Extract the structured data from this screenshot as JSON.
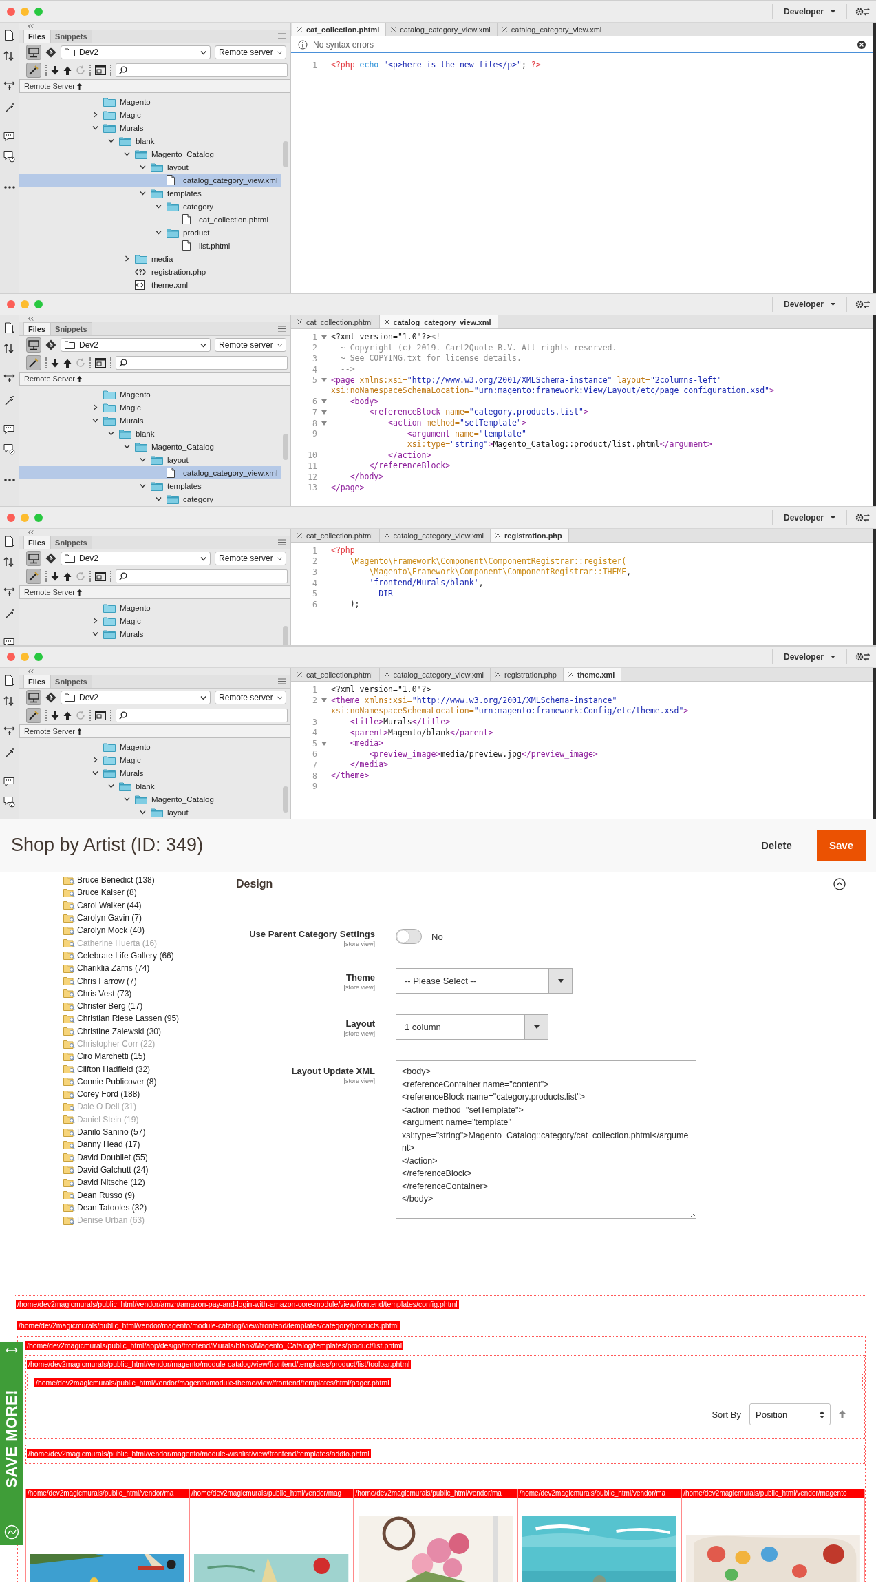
{
  "ide": {
    "panels": [
      {
        "workspace": "Developer",
        "files_tabs": [
          {
            "label": "Files",
            "selected": true
          },
          {
            "label": "Snippets",
            "selected": false
          }
        ],
        "site": "Dev2",
        "server": "Remote server",
        "tree_header": "Remote Server",
        "tree": [
          {
            "label": "Magento",
            "kind": "folder",
            "selected": false
          },
          {
            "label": "Magic",
            "kind": "folder",
            "expanded": false,
            "selected": false
          },
          {
            "label": "Murals",
            "kind": "folder",
            "expanded": true,
            "selected": false,
            "children": [
              {
                "label": "blank",
                "kind": "folder",
                "expanded": true,
                "selected": false,
                "children": [
                  {
                    "label": "Magento_Catalog",
                    "kind": "folder",
                    "expanded": true,
                    "selected": false,
                    "children": [
                      {
                        "label": "layout",
                        "kind": "folder",
                        "expanded": true,
                        "selected": false,
                        "children": [
                          {
                            "label": "catalog_category_view.xml",
                            "kind": "document",
                            "selected": true
                          }
                        ]
                      },
                      {
                        "label": "templates",
                        "kind": "folder",
                        "expanded": true,
                        "selected": false,
                        "children": [
                          {
                            "label": "category",
                            "kind": "folder",
                            "expanded": true,
                            "selected": false,
                            "children": [
                              {
                                "label": "cat_collection.phtml",
                                "kind": "document",
                                "selected": false
                              }
                            ]
                          },
                          {
                            "label": "product",
                            "kind": "folder",
                            "expanded": true,
                            "selected": false,
                            "children": [
                              {
                                "label": "list.phtml",
                                "kind": "document",
                                "selected": false
                              }
                            ]
                          }
                        ]
                      }
                    ]
                  },
                  {
                    "label": "media",
                    "kind": "folder",
                    "expanded": false,
                    "selected": false
                  },
                  {
                    "label": "registration.php",
                    "kind": "script",
                    "selected": false
                  },
                  {
                    "label": "theme.xml",
                    "kind": "markup",
                    "selected": false
                  }
                ]
              }
            ]
          }
        ],
        "editor_tabs": [
          {
            "label": "cat_collection.phtml",
            "selected": true
          },
          {
            "label": "catalog_category_view.xml",
            "selected": false
          },
          {
            "label": "catalog_category_view.xml",
            "selected": false
          }
        ],
        "status_message": "No syntax errors",
        "lines": [
          {
            "number": "1",
            "foldable": false,
            "tokens": [
              {
                "kind": "php",
                "text": "<?php"
              },
              {
                "kind": "keyword",
                "text": " echo "
              },
              {
                "kind": "string",
                "text": "\"<p>here is the new file</p>\""
              },
              {
                "kind": "plain",
                "text": "; "
              },
              {
                "kind": "php",
                "text": "?>"
              }
            ]
          }
        ]
      },
      {
        "workspace": "Developer",
        "files_tabs": [
          {
            "label": "Files",
            "selected": true
          },
          {
            "label": "Snippets",
            "selected": false
          }
        ],
        "site": "Dev2",
        "server": "Remote server",
        "tree_header": "Remote Server",
        "tree": [
          {
            "label": "Magento",
            "kind": "folder",
            "selected": false
          },
          {
            "label": "Magic",
            "kind": "folder",
            "expanded": false,
            "selected": false
          },
          {
            "label": "Murals",
            "kind": "folder",
            "expanded": true,
            "selected": false,
            "children": [
              {
                "label": "blank",
                "kind": "folder",
                "expanded": true,
                "selected": false,
                "children": [
                  {
                    "label": "Magento_Catalog",
                    "kind": "folder",
                    "expanded": true,
                    "selected": false,
                    "children": [
                      {
                        "label": "layout",
                        "kind": "folder",
                        "expanded": true,
                        "selected": false,
                        "children": [
                          {
                            "label": "catalog_category_view.xml",
                            "kind": "document",
                            "selected": true
                          }
                        ]
                      },
                      {
                        "label": "templates",
                        "kind": "folder",
                        "expanded": true,
                        "selected": false,
                        "children": [
                          {
                            "label": "category",
                            "kind": "folder",
                            "expanded": true,
                            "selected": false
                          }
                        ]
                      }
                    ]
                  }
                ]
              }
            ]
          }
        ],
        "editor_tabs": [
          {
            "label": "cat_collection.phtml",
            "selected": false
          },
          {
            "label": "catalog_category_view.xml",
            "selected": true
          }
        ],
        "lines": [
          {
            "number": "1",
            "foldable": true,
            "tokens": [
              {
                "kind": "plain",
                "text": "<?xml version=\"1.0\"?>"
              },
              {
                "kind": "comment",
                "text": "<!--"
              }
            ]
          },
          {
            "number": "2",
            "foldable": false,
            "tokens": [
              {
                "kind": "comment",
                "text": "  ~ Copyright (c) 2019. Cart2Quote B.V. All rights reserved."
              }
            ]
          },
          {
            "number": "3",
            "foldable": false,
            "tokens": [
              {
                "kind": "comment",
                "text": "  ~ See COPYING.txt for license details."
              }
            ]
          },
          {
            "number": "4",
            "foldable": false,
            "tokens": [
              {
                "kind": "comment",
                "text": "  -->"
              }
            ]
          },
          {
            "number": "5",
            "foldable": true,
            "tokens": [
              {
                "kind": "tag",
                "text": "<page"
              },
              {
                "kind": "attr",
                "text": " xmlns:xsi="
              },
              {
                "kind": "string",
                "text": "\"http://www.w3.org/2001/XMLSchema-instance\""
              },
              {
                "kind": "attr",
                "text": " layout="
              },
              {
                "kind": "string",
                "text": "\"2columns-left\""
              }
            ]
          },
          {
            "foldable": false,
            "tokens": [
              {
                "kind": "attr",
                "text": "xsi:noNamespaceSchemaLocation="
              },
              {
                "kind": "string",
                "text": "\"urn:magento:framework:View/Layout/etc/page_configuration.xsd\""
              },
              {
                "kind": "tag",
                "text": ">"
              }
            ]
          },
          {
            "number": "6",
            "foldable": true,
            "tokens": [
              {
                "kind": "tag",
                "text": "    <body>"
              }
            ]
          },
          {
            "number": "7",
            "foldable": true,
            "tokens": [
              {
                "kind": "tag",
                "text": "        <referenceBlock"
              },
              {
                "kind": "attr",
                "text": " name="
              },
              {
                "kind": "string",
                "text": "\"category.products.list\""
              },
              {
                "kind": "tag",
                "text": ">"
              }
            ]
          },
          {
            "number": "8",
            "foldable": true,
            "tokens": [
              {
                "kind": "tag",
                "text": "            <action"
              },
              {
                "kind": "attr",
                "text": " method="
              },
              {
                "kind": "string",
                "text": "\"setTemplate\""
              },
              {
                "kind": "tag",
                "text": ">"
              }
            ]
          },
          {
            "number": "9",
            "foldable": false,
            "tokens": [
              {
                "kind": "tag",
                "text": "                <argument"
              },
              {
                "kind": "attr",
                "text": " name="
              },
              {
                "kind": "string",
                "text": "\"template\""
              }
            ]
          },
          {
            "foldable": false,
            "tokens": [
              {
                "kind": "attr",
                "text": "                xsi:type="
              },
              {
                "kind": "string",
                "text": "\"string\""
              },
              {
                "kind": "tag",
                "text": ">"
              },
              {
                "kind": "plain",
                "text": "Magento_Catalog::product/list.phtml"
              },
              {
                "kind": "tag",
                "text": "</argument>"
              }
            ]
          },
          {
            "number": "10",
            "foldable": false,
            "tokens": [
              {
                "kind": "tag",
                "text": "            </action>"
              }
            ]
          },
          {
            "number": "11",
            "foldable": false,
            "tokens": [
              {
                "kind": "tag",
                "text": "        </referenceBlock>"
              }
            ]
          },
          {
            "number": "12",
            "foldable": false,
            "tokens": [
              {
                "kind": "tag",
                "text": "    </body>"
              }
            ]
          },
          {
            "number": "13",
            "foldable": false,
            "tokens": [
              {
                "kind": "tag",
                "text": "</page>"
              }
            ]
          }
        ]
      },
      {
        "workspace": "Developer",
        "files_tabs": [
          {
            "label": "Files",
            "selected": true
          },
          {
            "label": "Snippets",
            "selected": false
          }
        ],
        "site": "Dev2",
        "server": "Remote server",
        "tree_header": "Remote Server",
        "tree": [
          {
            "label": "Magento",
            "kind": "folder",
            "selected": false
          },
          {
            "label": "Magic",
            "kind": "folder",
            "expanded": false,
            "selected": false
          },
          {
            "label": "Murals",
            "kind": "folder",
            "expanded": true,
            "selected": false
          }
        ],
        "editor_tabs": [
          {
            "label": "cat_collection.phtml",
            "selected": false
          },
          {
            "label": "catalog_category_view.xml",
            "selected": false
          },
          {
            "label": "registration.php",
            "selected": true
          }
        ],
        "lines": [
          {
            "number": "1",
            "foldable": false,
            "tokens": [
              {
                "kind": "php",
                "text": "<?php"
              }
            ]
          },
          {
            "number": "2",
            "foldable": false,
            "tokens": [
              {
                "kind": "class",
                "text": "    \\Magento\\Framework\\Component\\ComponentRegistrar::register("
              }
            ]
          },
          {
            "number": "3",
            "foldable": false,
            "tokens": [
              {
                "kind": "class",
                "text": "        \\Magento\\Framework\\Component\\ComponentRegistrar::THEME"
              },
              {
                "kind": "plain",
                "text": ","
              }
            ]
          },
          {
            "number": "4",
            "foldable": false,
            "tokens": [
              {
                "kind": "string",
                "text": "        'frontend/Murals/blank'"
              },
              {
                "kind": "plain",
                "text": ","
              }
            ]
          },
          {
            "number": "5",
            "foldable": false,
            "tokens": [
              {
                "kind": "string",
                "text": "        __DIR__"
              }
            ]
          },
          {
            "number": "6",
            "foldable": false,
            "tokens": [
              {
                "kind": "plain",
                "text": "    );"
              }
            ]
          }
        ]
      },
      {
        "workspace": "Developer",
        "files_tabs": [
          {
            "label": "Files",
            "selected": true
          },
          {
            "label": "Snippets",
            "selected": false
          }
        ],
        "site": "Dev2",
        "server": "Remote server",
        "tree_header": "Remote Server",
        "tree": [
          {
            "label": "Magento",
            "kind": "folder",
            "selected": false
          },
          {
            "label": "Magic",
            "kind": "folder",
            "expanded": false,
            "selected": false
          },
          {
            "label": "Murals",
            "kind": "folder",
            "expanded": true,
            "selected": false,
            "children": [
              {
                "label": "blank",
                "kind": "folder",
                "expanded": true,
                "selected": false,
                "children": [
                  {
                    "label": "Magento_Catalog",
                    "kind": "folder",
                    "expanded": true,
                    "selected": false,
                    "children": [
                      {
                        "label": "layout",
                        "kind": "folder",
                        "expanded": true,
                        "selected": false
                      }
                    ]
                  }
                ]
              }
            ]
          }
        ],
        "editor_tabs": [
          {
            "label": "cat_collection.phtml",
            "selected": false
          },
          {
            "label": "catalog_category_view.xml",
            "selected": false
          },
          {
            "label": "registration.php",
            "selected": false
          },
          {
            "label": "theme.xml",
            "selected": true
          }
        ],
        "lines": [
          {
            "number": "1",
            "foldable": false,
            "tokens": [
              {
                "kind": "plain",
                "text": "<?xml version=\"1.0\"?>"
              }
            ]
          },
          {
            "number": "2",
            "foldable": true,
            "tokens": [
              {
                "kind": "tag",
                "text": "<theme"
              },
              {
                "kind": "attr",
                "text": " xmlns:xsi="
              },
              {
                "kind": "string",
                "text": "\"http://www.w3.org/2001/XMLSchema-instance\""
              }
            ]
          },
          {
            "foldable": false,
            "tokens": [
              {
                "kind": "attr",
                "text": "xsi:noNamespaceSchemaLocation="
              },
              {
                "kind": "string",
                "text": "\"urn:magento:framework:Config/etc/theme.xsd\""
              },
              {
                "kind": "tag",
                "text": ">"
              }
            ]
          },
          {
            "number": "3",
            "foldable": false,
            "tokens": [
              {
                "kind": "tag",
                "text": "    <title>"
              },
              {
                "kind": "plain",
                "text": "Murals"
              },
              {
                "kind": "tag",
                "text": "</title>"
              }
            ]
          },
          {
            "number": "4",
            "foldable": false,
            "tokens": [
              {
                "kind": "tag",
                "text": "    <parent>"
              },
              {
                "kind": "plain",
                "text": "Magento/blank"
              },
              {
                "kind": "tag",
                "text": "</parent>"
              }
            ]
          },
          {
            "number": "5",
            "foldable": true,
            "tokens": [
              {
                "kind": "tag",
                "text": "    <media>"
              }
            ]
          },
          {
            "number": "6",
            "foldable": false,
            "tokens": [
              {
                "kind": "tag",
                "text": "        <preview_image>"
              },
              {
                "kind": "plain",
                "text": "media/preview.jpg"
              },
              {
                "kind": "tag",
                "text": "</preview_image>"
              }
            ]
          },
          {
            "number": "7",
            "foldable": false,
            "tokens": [
              {
                "kind": "tag",
                "text": "    </media>"
              }
            ]
          },
          {
            "number": "8",
            "foldable": false,
            "tokens": [
              {
                "kind": "tag",
                "text": "</theme>"
              }
            ]
          },
          {
            "number": "9",
            "foldable": false
          }
        ]
      }
    ]
  },
  "admin": {
    "title": "Shop by Artist (ID: 349)",
    "delete": "Delete",
    "save": "Save",
    "artists": [
      {
        "label": "Bruce Benedict (138)",
        "disabled": false
      },
      {
        "label": "Bruce Kaiser (8)",
        "disabled": false
      },
      {
        "label": "Carol Walker (44)",
        "disabled": false
      },
      {
        "label": "Carolyn Gavin (7)",
        "disabled": false
      },
      {
        "label": "Carolyn Mock (40)",
        "disabled": false
      },
      {
        "label": "Catherine Huerta (16)",
        "disabled": true
      },
      {
        "label": "Celebrate Life Gallery (66)",
        "disabled": false
      },
      {
        "label": "Chariklia Zarris (74)",
        "disabled": false
      },
      {
        "label": "Chris Farrow (7)",
        "disabled": false
      },
      {
        "label": "Chris Vest (73)",
        "disabled": false
      },
      {
        "label": "Christer Berg (17)",
        "disabled": false
      },
      {
        "label": "Christian Riese Lassen (95)",
        "disabled": false
      },
      {
        "label": "Christine Zalewski (30)",
        "disabled": false
      },
      {
        "label": "Christopher Corr (22)",
        "disabled": true
      },
      {
        "label": "Ciro Marchetti (15)",
        "disabled": false
      },
      {
        "label": "Clifton Hadfield (32)",
        "disabled": false
      },
      {
        "label": "Connie Publicover (8)",
        "disabled": false
      },
      {
        "label": "Corey Ford (188)",
        "disabled": false
      },
      {
        "label": "Dale O Dell (31)",
        "disabled": true
      },
      {
        "label": "Daniel Stein (19)",
        "disabled": true
      },
      {
        "label": "Danilo Sanino (57)",
        "disabled": false
      },
      {
        "label": "Danny Head (17)",
        "disabled": false
      },
      {
        "label": "David Doubilet (55)",
        "disabled": false
      },
      {
        "label": "David Galchutt (24)",
        "disabled": false
      },
      {
        "label": "David Nitsche (12)",
        "disabled": false
      },
      {
        "label": "Dean Russo (9)",
        "disabled": false
      },
      {
        "label": "Dean Tatooles (32)",
        "disabled": false
      },
      {
        "label": "Denise Urban (63)",
        "disabled": true
      }
    ],
    "section": {
      "title": "Design",
      "expanded": true
    },
    "fields": [
      {
        "kind": "toggle",
        "label": "Use Parent Category Settings",
        "scope": "[store view]",
        "on": false,
        "value": "No"
      },
      {
        "kind": "select",
        "label": "Theme",
        "scope": "[store view]",
        "value": "-- Please Select --"
      },
      {
        "kind": "select",
        "label": "Layout",
        "scope": "[store view]",
        "value": "1 column"
      },
      {
        "kind": "textarea",
        "label": "Layout Update XML",
        "scope": "[store view]",
        "value": "<body>\n<referenceContainer name=\"content\">\n<referenceBlock name=\"category.products.list\">\n<action method=\"setTemplate\">\n<argument name=\"template\"\nxsi:type=\"string\">Magento_Catalog::category/cat_collection.phtml</argument>\n</action>\n</referenceBlock>\n</referenceContainer>\n</body>"
      }
    ]
  },
  "storefront": {
    "save_more": "SAVE MORE!",
    "hints": [
      "/home/dev2magicmurals/public_html/vendor/amzn/amazon-pay-and-login-with-amazon-core-module/view/frontend/templates/config.phtml",
      "/home/dev2magicmurals/public_html/vendor/magento/module-catalog/view/frontend/templates/category/products.phtml",
      "/home/dev2magicmurals/public_html/app/design/frontend/Murals/blank/Magento_Catalog/templates/product/list.phtml",
      "/home/dev2magicmurals/public_html/vendor/magento/module-catalog/view/frontend/templates/product/list/toolbar.phtml",
      "/home/dev2magicmurals/public_html/vendor/magento/module-theme/view/frontend/templates/html/pager.phtml",
      "/home/dev2magicmurals/public_html/vendor/magento/module-wishlist/view/frontend/templates/addto.phtml"
    ],
    "sort": {
      "label": "Sort By",
      "value": "Position"
    },
    "products": [
      {
        "hint": "/home/dev2magicmurals/public_html/vendor/ma",
        "kind": "picture"
      },
      {
        "hint": "/home/dev2magicmurals/public_html/vendor/mag",
        "kind": "picture"
      },
      {
        "hint": "/home/dev2magicmurals/public_html/vendor/ma",
        "kind": "picture"
      },
      {
        "hint": "/home/dev2magicmurals/public_html/vendor/ma",
        "kind": "picture"
      },
      {
        "hint": "/home/dev2magicmurals/public_html/vendor/magento",
        "kind": "picture"
      }
    ]
  }
}
